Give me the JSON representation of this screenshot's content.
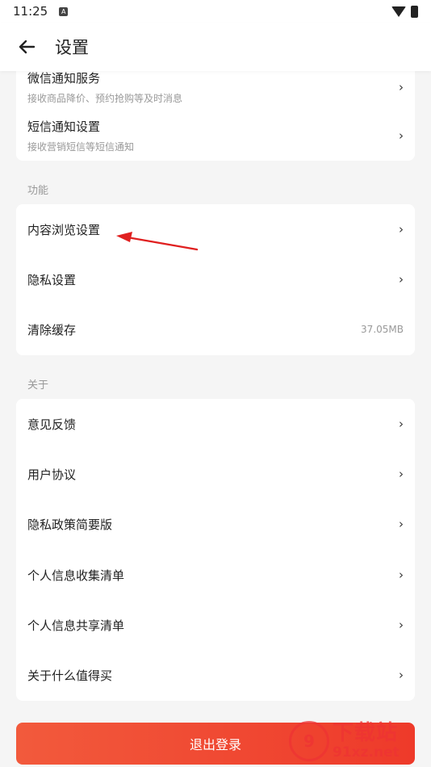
{
  "status_bar": {
    "time": "11:25",
    "notification_icon": "A"
  },
  "header": {
    "title": "设置"
  },
  "notifications": [
    {
      "title": "微信通知服务",
      "subtitle": "接收商品降价、预约抢购等及时消息",
      "chevron": "›"
    },
    {
      "title": "短信通知设置",
      "subtitle": "接收营销短信等短信通知",
      "chevron": "›"
    }
  ],
  "features": {
    "label": "功能",
    "items": [
      {
        "title": "内容浏览设置",
        "chevron": "›"
      },
      {
        "title": "隐私设置",
        "chevron": "›"
      },
      {
        "title": "清除缓存",
        "value": "37.05MB"
      }
    ]
  },
  "about": {
    "label": "关于",
    "items": [
      {
        "title": "意见反馈",
        "chevron": "›"
      },
      {
        "title": "用户协议",
        "chevron": "›"
      },
      {
        "title": "隐私政策简要版",
        "chevron": "›"
      },
      {
        "title": "个人信息收集清单",
        "chevron": "›"
      },
      {
        "title": "个人信息共享清单",
        "chevron": "›"
      },
      {
        "title": "关于什么值得买",
        "chevron": "›"
      }
    ]
  },
  "logout": {
    "label": "退出登录"
  },
  "watermark": {
    "logo": "9",
    "text": "下载站",
    "url": "91xz.net"
  },
  "colors": {
    "accent": "#ee3a2a",
    "background": "#f5f5f5",
    "annotation": "#e02020"
  },
  "icons": [
    "back-arrow-icon",
    "wifi-icon",
    "battery-icon",
    "chevron-right-icon"
  ]
}
